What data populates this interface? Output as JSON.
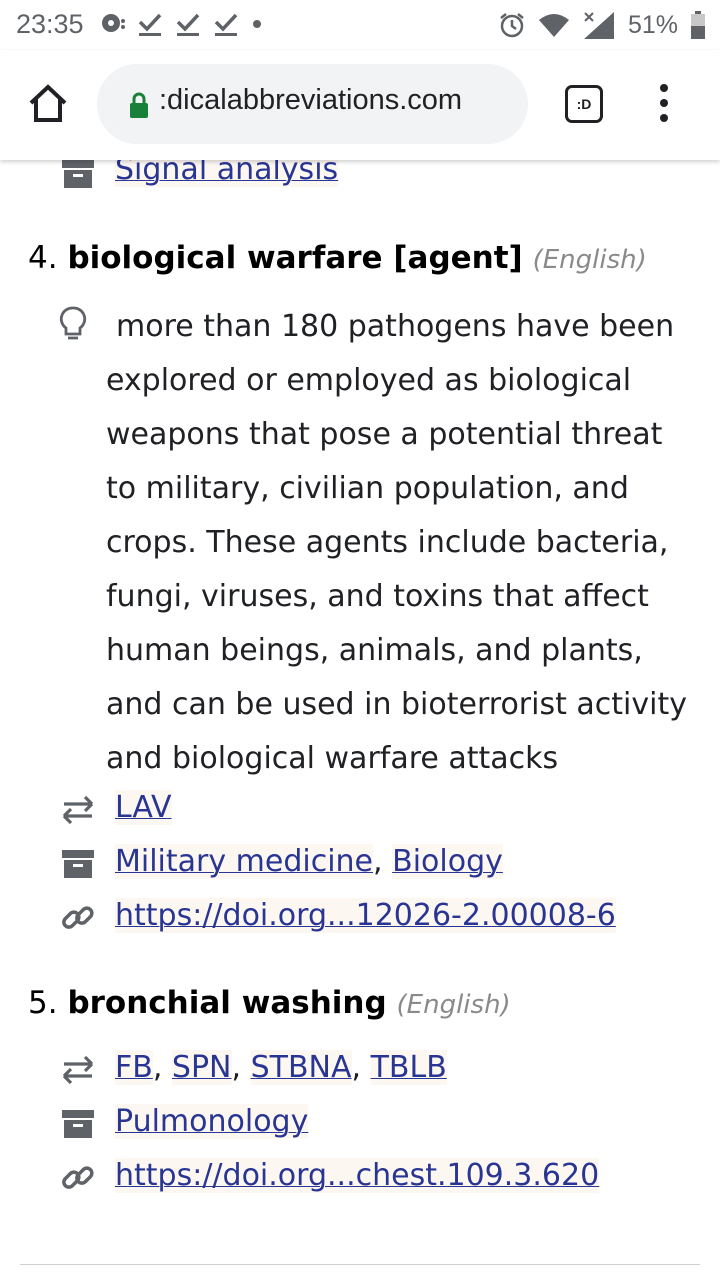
{
  "status_bar": {
    "time": "23:35",
    "battery_percent": "51%",
    "battery_level": 0.51
  },
  "browser": {
    "url_display": ":dicalabbreviations.com",
    "tab_badge": ":D"
  },
  "top_partial_row": {
    "icon": "archive-icon",
    "links": [
      "Signal analysis"
    ]
  },
  "entries": [
    {
      "number": "4.",
      "term": "biological warfare [agent]",
      "language": "(English)",
      "definition": "more than 180 pathogens have been explored or employed as biological weapons that pose a potential threat to military, civilian population, and crops. These agents include bacteria, fungi, viruses, and toxins that affect human beings, animals, and plants, and can be used in bioterrorist activity and biological warfare attacks",
      "abbreviations": [
        "LAV"
      ],
      "categories": [
        "Military medicine",
        "Biology"
      ],
      "source": "https://doi.org...12026-2.00008-6"
    },
    {
      "number": "5.",
      "term": "bronchial washing",
      "language": "(English)",
      "abbreviations": [
        "FB",
        "SPN",
        "STBNA",
        "TBLB"
      ],
      "categories": [
        "Pulmonology"
      ],
      "source": "https://doi.org...chest.109.3.620"
    }
  ],
  "separator": ", ",
  "colors": {
    "link": "#283593",
    "icon": "#5f6368",
    "secure_lock": "#188038"
  }
}
